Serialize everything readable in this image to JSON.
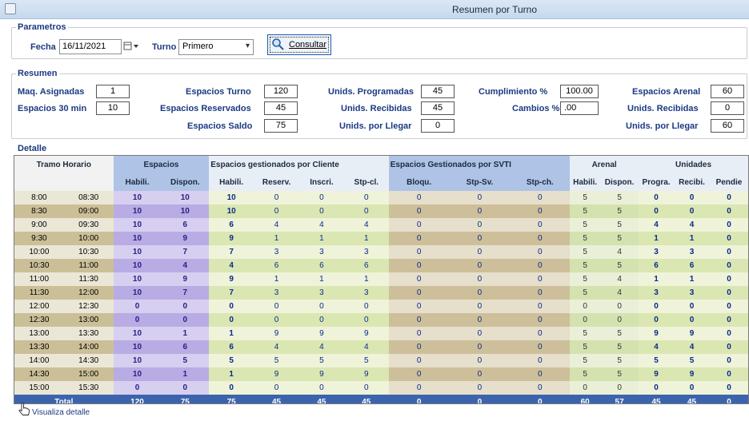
{
  "window": {
    "title": "Resumen por Turno"
  },
  "parametros": {
    "group_label": "Parametros",
    "fecha_label": "Fecha",
    "fecha_value": "16/11/2021",
    "turno_label": "Turno",
    "turno_value": "Primero",
    "consultar_label": "Consultar"
  },
  "resumen": {
    "group_label": "Resumen",
    "maq_asignadas": {
      "label": "Maq. Asignadas",
      "value": "1"
    },
    "espacios_30min": {
      "label": "Espacios 30 min",
      "value": "10"
    },
    "espacios_turno": {
      "label": "Espacios Turno",
      "value": "120"
    },
    "espacios_reservados": {
      "label": "Espacios Reservados",
      "value": "45"
    },
    "espacios_saldo": {
      "label": "Espacios Saldo",
      "value": "75"
    },
    "unids_programadas": {
      "label": "Unids. Programadas",
      "value": "45"
    },
    "unids_recibidas": {
      "label": "Unids. Recibidas",
      "value": "45"
    },
    "unids_por_llegar": {
      "label": "Unids. por Llegar",
      "value": "0"
    },
    "cumplimiento": {
      "label": "Cumplimiento %",
      "value": "100.00"
    },
    "cambios": {
      "label": "Cambios %",
      "value": ".00"
    },
    "espacios_arenal": {
      "label": "Espacios Arenal",
      "value": "60"
    },
    "unids_recibidas_arenal": {
      "label": "Unids. Recibidas",
      "value": "0"
    },
    "unids_por_llegar_arenal": {
      "label": "Unids. por Llegar",
      "value": "60"
    }
  },
  "detalle": {
    "group_label": "Detalle",
    "group_headers": {
      "tramo": "Tramo Horario",
      "espacios": "Espacios",
      "cliente": "Espacios gestionados por Cliente",
      "svti": "Espacios Gestionados por SVTI",
      "arenal": "Arenal",
      "unidades": "Unidades"
    },
    "columns": [
      "Habili.",
      "Dispon.",
      "Habili.",
      "Reserv.",
      "Inscri.",
      "Stp-cl.",
      "Bloqu.",
      "Stp-Sv.",
      "Stp-ch.",
      "Habili.",
      "Dispon.",
      "Progra.",
      "Recibi.",
      "Pendie"
    ],
    "rows": [
      [
        "8:00",
        "08:30",
        "10",
        "10",
        "10",
        "0",
        "0",
        "0",
        "0",
        "0",
        "0",
        "5",
        "5",
        "0",
        "0",
        "0"
      ],
      [
        "8:30",
        "09:00",
        "10",
        "10",
        "10",
        "0",
        "0",
        "0",
        "0",
        "0",
        "0",
        "5",
        "5",
        "0",
        "0",
        "0"
      ],
      [
        "9:00",
        "09:30",
        "10",
        "6",
        "6",
        "4",
        "4",
        "4",
        "0",
        "0",
        "0",
        "5",
        "5",
        "4",
        "4",
        "0"
      ],
      [
        "9:30",
        "10:00",
        "10",
        "9",
        "9",
        "1",
        "1",
        "1",
        "0",
        "0",
        "0",
        "5",
        "5",
        "1",
        "1",
        "0"
      ],
      [
        "10:00",
        "10:30",
        "10",
        "7",
        "7",
        "3",
        "3",
        "3",
        "0",
        "0",
        "0",
        "5",
        "4",
        "3",
        "3",
        "0"
      ],
      [
        "10:30",
        "11:00",
        "10",
        "4",
        "4",
        "6",
        "6",
        "6",
        "0",
        "0",
        "0",
        "5",
        "5",
        "6",
        "6",
        "0"
      ],
      [
        "11:00",
        "11:30",
        "10",
        "9",
        "9",
        "1",
        "1",
        "1",
        "0",
        "0",
        "0",
        "5",
        "4",
        "1",
        "1",
        "0"
      ],
      [
        "11:30",
        "12:00",
        "10",
        "7",
        "7",
        "3",
        "3",
        "3",
        "0",
        "0",
        "0",
        "5",
        "4",
        "3",
        "3",
        "0"
      ],
      [
        "12:00",
        "12:30",
        "0",
        "0",
        "0",
        "0",
        "0",
        "0",
        "0",
        "0",
        "0",
        "0",
        "0",
        "0",
        "0",
        "0"
      ],
      [
        "12:30",
        "13:00",
        "0",
        "0",
        "0",
        "0",
        "0",
        "0",
        "0",
        "0",
        "0",
        "0",
        "0",
        "0",
        "0",
        "0"
      ],
      [
        "13:00",
        "13:30",
        "10",
        "1",
        "1",
        "9",
        "9",
        "9",
        "0",
        "0",
        "0",
        "5",
        "5",
        "9",
        "9",
        "0"
      ],
      [
        "13:30",
        "14:00",
        "10",
        "6",
        "6",
        "4",
        "4",
        "4",
        "0",
        "0",
        "0",
        "5",
        "5",
        "4",
        "4",
        "0"
      ],
      [
        "14:00",
        "14:30",
        "10",
        "5",
        "5",
        "5",
        "5",
        "5",
        "0",
        "0",
        "0",
        "5",
        "5",
        "5",
        "5",
        "0"
      ],
      [
        "14:30",
        "15:00",
        "10",
        "1",
        "1",
        "9",
        "9",
        "9",
        "0",
        "0",
        "0",
        "5",
        "5",
        "9",
        "9",
        "0"
      ],
      [
        "15:00",
        "15:30",
        "0",
        "0",
        "0",
        "0",
        "0",
        "0",
        "0",
        "0",
        "0",
        "0",
        "0",
        "0",
        "0",
        "0"
      ]
    ],
    "total_label": "Total",
    "totals": [
      "120",
      "75",
      "75",
      "45",
      "45",
      "45",
      "0",
      "0",
      "0",
      "60",
      "57",
      "45",
      "45",
      "0"
    ]
  },
  "footer": {
    "link_label": "Visualiza detalle"
  }
}
